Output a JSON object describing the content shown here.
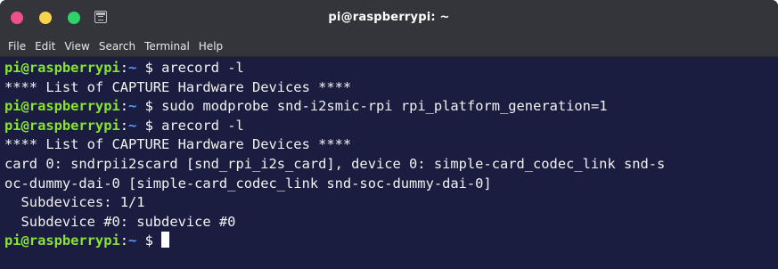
{
  "window": {
    "title": "pi@raspberrypi: ~"
  },
  "menu": {
    "items": [
      "File",
      "Edit",
      "View",
      "Search",
      "Terminal",
      "Help"
    ]
  },
  "prompt": {
    "user_host": "pi@raspberrypi",
    "separator": ":",
    "path": "~",
    "symbol": " $ "
  },
  "terminal": {
    "lines": [
      {
        "type": "command",
        "text": "arecord -l"
      },
      {
        "type": "output",
        "text": "**** List of CAPTURE Hardware Devices ****"
      },
      {
        "type": "command",
        "text": "sudo modprobe snd-i2smic-rpi rpi_platform_generation=1"
      },
      {
        "type": "command",
        "text": "arecord -l"
      },
      {
        "type": "output",
        "text": "**** List of CAPTURE Hardware Devices ****"
      },
      {
        "type": "output",
        "text": "card 0: sndrpii2scard [snd_rpi_i2s_card], device 0: simple-card_codec_link snd-s"
      },
      {
        "type": "output",
        "text": "oc-dummy-dai-0 [simple-card_codec_link snd-soc-dummy-dai-0]"
      },
      {
        "type": "output",
        "text": "  Subdevices: 1/1"
      },
      {
        "type": "output",
        "text": "  Subdevice #0: subdevice #0"
      },
      {
        "type": "command",
        "text": ""
      }
    ]
  },
  "colors": {
    "prompt_user": "#8ae234",
    "prompt_path": "#5a9df8",
    "background": "#1a1d3f",
    "titlebar": "#33353b"
  }
}
